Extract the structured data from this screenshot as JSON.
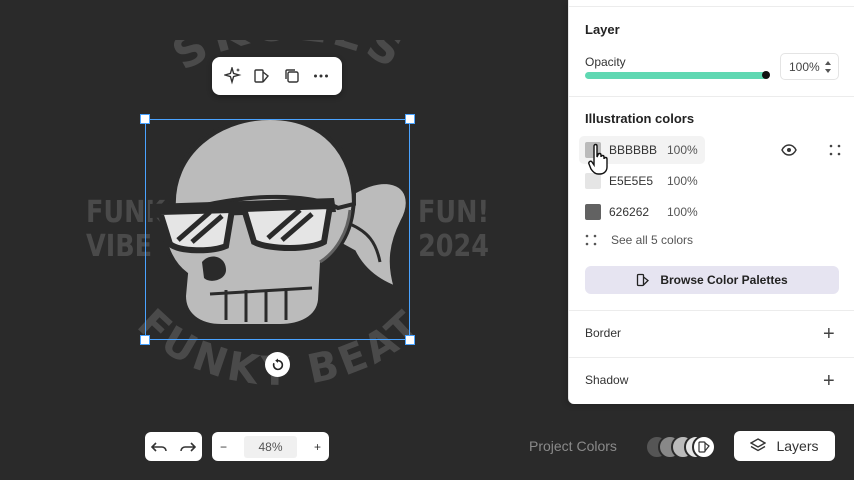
{
  "artwork": {
    "arc_top_text": "SKULLS",
    "left_text_1": "FUNK",
    "left_text_2": "VIBE",
    "right_text_1": "FUN!",
    "right_text_2": "2024",
    "arc_bottom_text": "FUNKY BEAT"
  },
  "floating_toolbar": {
    "icons": [
      "sparkle-icon",
      "shape-edit-icon",
      "duplicate-icon",
      "more-icon"
    ]
  },
  "zoom": {
    "value": "48%",
    "minus": "−",
    "plus": "+"
  },
  "panel": {
    "layer_title": "Layer",
    "opacity_label": "Opacity",
    "opacity_value": "100%",
    "opacity_fraction": 1.0,
    "illustration_title": "Illustration colors",
    "colors": [
      {
        "hex": "BBBBBB",
        "pct": "100%",
        "color": "#bbbbbb"
      },
      {
        "hex": "E5E5E5",
        "pct": "100%",
        "color": "#e5e5e5"
      },
      {
        "hex": "626262",
        "pct": "100%",
        "color": "#626262"
      }
    ],
    "see_all": "See all 5 colors",
    "browse_label": "Browse Color Palettes",
    "border_label": "Border",
    "shadow_label": "Shadow",
    "plus": "+"
  },
  "bottom": {
    "project_colors": "Project Colors",
    "layers_label": "Layers"
  },
  "accent": {
    "opacity_bar": "#5fd8b2",
    "selection": "#4aa3ff"
  }
}
